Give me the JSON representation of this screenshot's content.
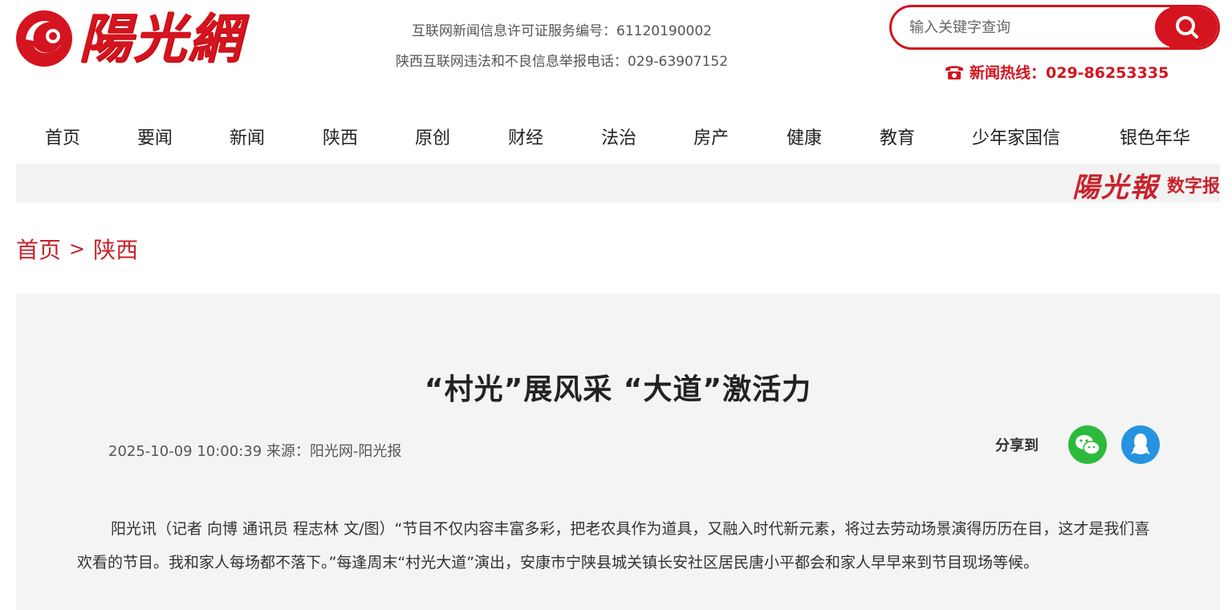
{
  "header": {
    "logo_text": "陽光網",
    "license_line1": "互联网新闻信息许可证服务编号：61120190002",
    "license_line2": "陕西互联网违法和不良信息举报电话：029-63907152",
    "search_placeholder": "输入关键字查询",
    "hotline": "新闻热线：029-86253335",
    "brand_color": "#d4141f"
  },
  "nav": {
    "items": [
      {
        "label": "首页"
      },
      {
        "label": "要闻"
      },
      {
        "label": "新闻"
      },
      {
        "label": "陕西"
      },
      {
        "label": "原创"
      },
      {
        "label": "财经"
      },
      {
        "label": "法治"
      },
      {
        "label": "房产"
      },
      {
        "label": "健康"
      },
      {
        "label": "教育"
      },
      {
        "label": "少年家国信"
      },
      {
        "label": "银色年华"
      }
    ]
  },
  "banner": {
    "paper_name": "陽光報",
    "digital_label": "数字报"
  },
  "breadcrumb": {
    "home": "首页",
    "separator": ">",
    "current": "陕西"
  },
  "article": {
    "title": "“村光”展风采 “大道”激活力",
    "meta": "2025-10-09 10:00:39 来源：阳光网-阳光报",
    "share_label": "分享到",
    "share_icons": [
      "wechat-icon",
      "qq-icon"
    ],
    "paragraph1": "阳光讯（记者 向博 通讯员 程志林 文/图）“节目不仅内容丰富多彩，把老农具作为道具，又融入时代新元素，将过去劳动场景演得历历在目，这才是我们喜欢看的节目。我和家人每场都不落下。”每逢周末“村光大道”演出，安康市宁陕县城关镇长安社区居民唐小平都会和家人早早来到节目现场等候。"
  }
}
